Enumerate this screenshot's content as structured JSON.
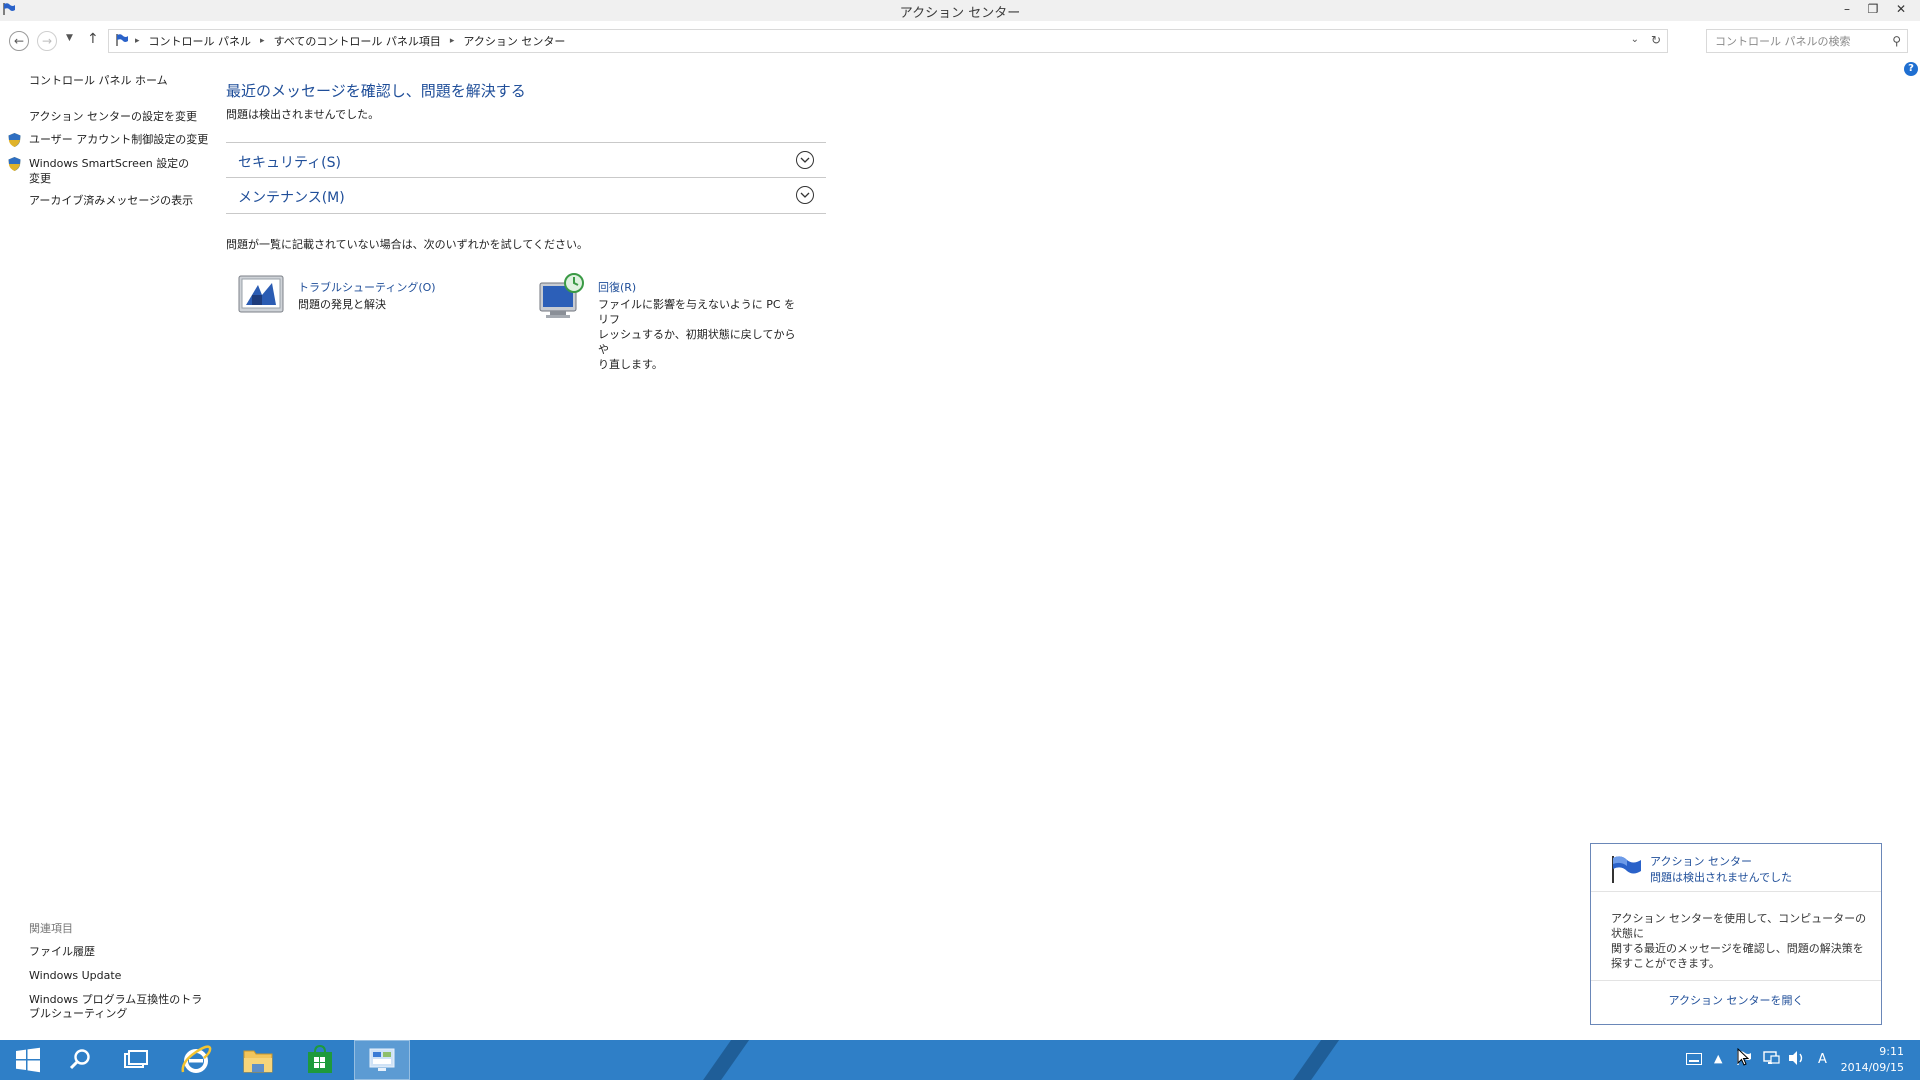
{
  "window": {
    "title": "アクション センター"
  },
  "address": {
    "breadcrumbs": [
      "コントロール パネル",
      "すべてのコントロール パネル項目",
      "アクション センター"
    ],
    "search_placeholder": "コントロール パネルの検索"
  },
  "sidebar": {
    "home": "コントロール パネル ホーム",
    "links": [
      "アクション センターの設定を変更",
      "ユーザー アカウント制御設定の変更",
      "Windows SmartScreen 設定の",
      "変更",
      "アーカイブ済みメッセージの表示"
    ],
    "related_title": "関連項目",
    "related_links": [
      "ファイル履歴",
      "Windows Update",
      "Windows プログラム互換性のトラ",
      "ブルシューティング"
    ]
  },
  "main": {
    "heading": "最近のメッセージを確認し、問題を解決する",
    "status": "問題は検出されませんでした。",
    "sections": [
      "セキュリティ(S)",
      "メンテナンス(M)"
    ],
    "hint": "問題が一覧に記載されていない場合は、次のいずれかを試してください。",
    "troubleshoot": {
      "title": "トラブルシューティング(O)",
      "desc": "問題の発見と解決"
    },
    "recovery": {
      "title": "回復(R)",
      "desc_lines": [
        "ファイルに影響を与えないように PC をリフ",
        "レッシュするか、初期状態に戻してからや",
        "り直します。"
      ]
    }
  },
  "popup": {
    "title": "アクション センター",
    "subtitle": "問題は検出されませんでした",
    "body_lines": [
      "アクション センターを使用して、コンピューターの状態に",
      "関する最近のメッセージを確認し、問題の解決策を",
      "探すことができます。"
    ],
    "link": "アクション センターを開く"
  },
  "taskbar": {
    "ime": "A",
    "time": "9:11",
    "date": "2014/09/15"
  },
  "colors": {
    "link": "#1f4e99",
    "taskbar": "#2f7fc7"
  }
}
